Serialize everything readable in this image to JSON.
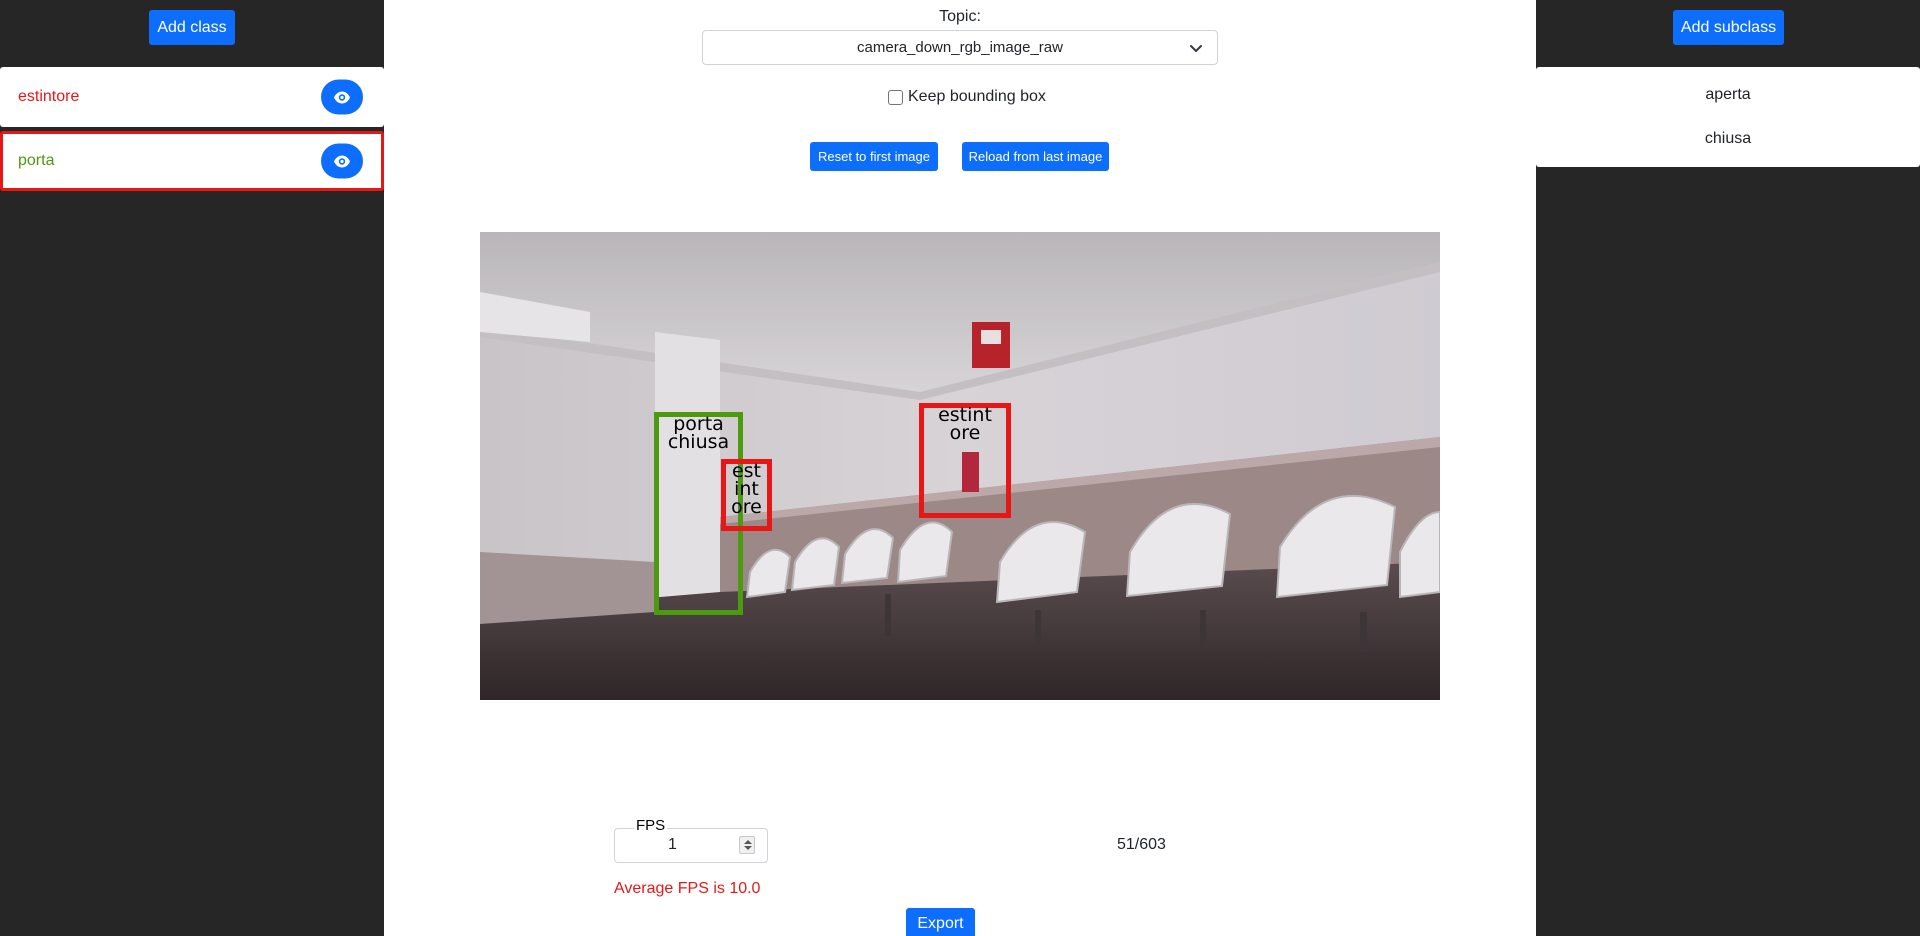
{
  "left_sidebar": {
    "add_class_label": "Add class",
    "classes": [
      {
        "label": "estintore",
        "color": "#e81717",
        "selected": false
      },
      {
        "label": "porta",
        "color": "#4c9a0f",
        "selected": true
      }
    ]
  },
  "main": {
    "topic_label": "Topic:",
    "topic_value": "camera_down_rgb_image_raw",
    "keep_bbox_label": "Keep bounding box",
    "keep_bbox_checked": false,
    "reset_label": "Reset to first image",
    "reload_label": "Reload from last image",
    "annotations": [
      {
        "class": "porta",
        "subclass": "chiusa",
        "text": [
          "porta",
          "chiusa"
        ],
        "color": "#4c9a0f"
      },
      {
        "class": "estintore",
        "text": [
          "est",
          "int",
          "ore"
        ],
        "color": "#e81717"
      },
      {
        "class": "estintore",
        "text": [
          "estint",
          "ore"
        ],
        "color": "#e81717"
      }
    ],
    "fps_legend": "FPS",
    "fps_value": "1",
    "frame_counter": "51/603",
    "average_fps": "Average FPS is 10.0",
    "export_label": "Export"
  },
  "right_sidebar": {
    "add_subclass_label": "Add subclass",
    "subclasses": [
      "aperta",
      "chiusa"
    ]
  },
  "colors": {
    "primary": "#0d6efd",
    "sidebar_bg": "#262626",
    "estintore": "#e81717",
    "porta": "#4c9a0f"
  }
}
